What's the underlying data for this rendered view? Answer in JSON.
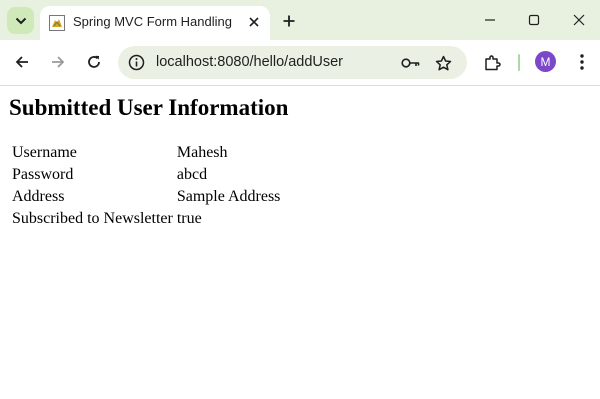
{
  "browser": {
    "tab": {
      "title": "Spring MVC Form Handling",
      "favicon": "spring-tomcat-favicon-icon"
    },
    "address_bar": {
      "url": "localhost:8080/hello/addUser"
    },
    "profile": {
      "initial": "M",
      "color": "#7a48c9"
    },
    "accent_colors": {
      "titlebar": "#e8f1df",
      "omnibox": "#eaf0e4",
      "tab_search": "#cfe9b9"
    }
  },
  "page": {
    "heading": "Submitted User Information",
    "rows": [
      {
        "label": "Username",
        "value": "Mahesh"
      },
      {
        "label": "Password",
        "value": "abcd"
      },
      {
        "label": "Address",
        "value": "Sample Address"
      },
      {
        "label": "Subscribed to Newsletter",
        "value": "true"
      }
    ]
  }
}
